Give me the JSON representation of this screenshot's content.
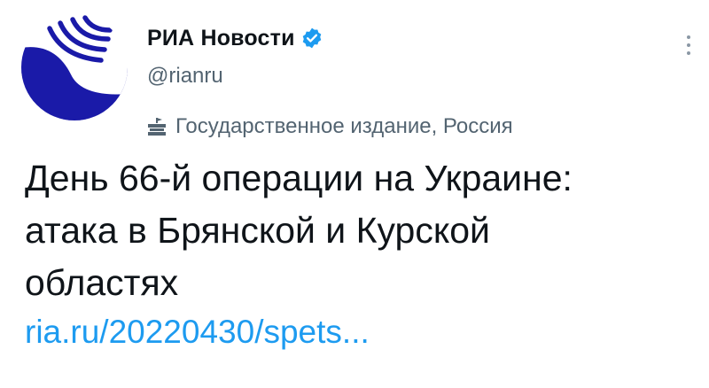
{
  "author": {
    "display_name": "РИА Новости",
    "handle": "@rianru",
    "verified": true,
    "affiliation_label": "Государственное издание, Россия",
    "avatar_icon": "ria-novosti-logo-icon"
  },
  "tweet": {
    "lines": [
      "День 66-й операции на Украине:",
      "атака в Брянской и Курской",
      "областях"
    ],
    "link_text": "ria.ru/20220430/spets..."
  },
  "colors": {
    "brand_blue": "#1a1aa8",
    "link": "#1d9bf0",
    "verified": "#1d9bf0",
    "secondary_text": "#536471"
  },
  "icons": [
    "ria-novosti-logo-icon",
    "verified-badge-icon",
    "government-building-icon",
    "more-options-icon"
  ]
}
